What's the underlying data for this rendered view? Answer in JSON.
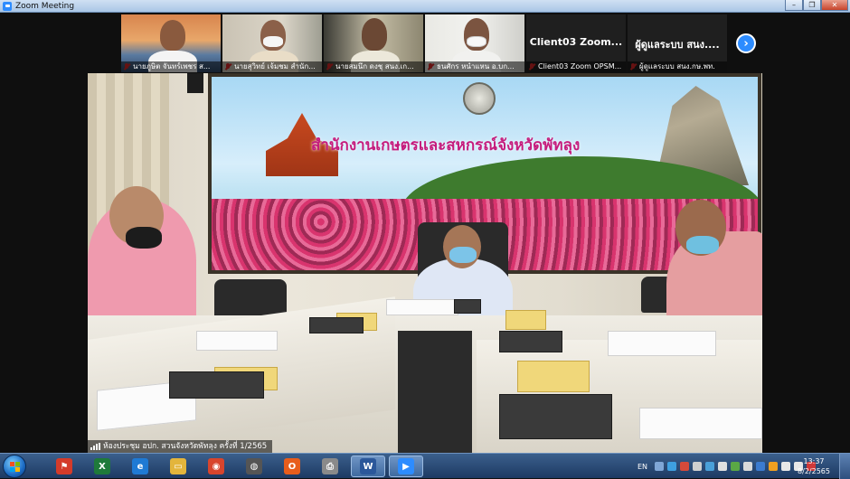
{
  "window": {
    "title": "Zoom Meeting",
    "minimize": "–",
    "maximize": "❐",
    "close": "✕"
  },
  "thumbnails": [
    {
      "name": "นายภูษิต จันทร์เพชร ส...",
      "muted": true
    },
    {
      "name": "นายสุวิทย์ เจ้มชม สำนัก...",
      "muted": true
    },
    {
      "name": "นายสมนึก ดงชุ สนง.เก...",
      "muted": true
    },
    {
      "name": "ธนศักร หนำแหน อ.บก...",
      "muted": true
    },
    {
      "name": "Client03 Zoom OPSM...",
      "big_label": "Client03  Zoom...",
      "muted": true
    },
    {
      "name": "ผู้ดูแลระบบ สนง.กษ.พท.",
      "big_label": "ผู้ดูแลระบบ สนง....",
      "muted": true
    }
  ],
  "next_icon": "›",
  "main": {
    "banner_title": "สำนักงานเกษตรและสหกรณ์จังหวัดพัทลุง",
    "room_label": "ห้องประชุม อปก. สวนจังหวัดพัทลุง ครั้งที่ 1/2565"
  },
  "taskbar": {
    "apps": [
      {
        "name": "flag-icon",
        "glyph": "⚑",
        "color": "#d43b2a"
      },
      {
        "name": "excel-icon",
        "glyph": "X",
        "color": "#1f7a3a"
      },
      {
        "name": "ie-icon",
        "glyph": "e",
        "color": "#1f7ad4"
      },
      {
        "name": "folder-icon",
        "glyph": "▭",
        "color": "#e3b53c"
      },
      {
        "name": "chrome-icon",
        "glyph": "◉",
        "color": "#d8452d"
      },
      {
        "name": "camera-icon",
        "glyph": "◍",
        "color": "#555555"
      },
      {
        "name": "office-icon",
        "glyph": "O",
        "color": "#e85d1c"
      },
      {
        "name": "printer-icon",
        "glyph": "⎙",
        "color": "#8a8a8a"
      },
      {
        "name": "word-icon",
        "glyph": "W",
        "color": "#2b579a"
      },
      {
        "name": "zoom-icon",
        "glyph": "▶",
        "color": "#2d8cff"
      }
    ],
    "language": "EN",
    "time": "13:37",
    "date": "8/2/2565"
  }
}
